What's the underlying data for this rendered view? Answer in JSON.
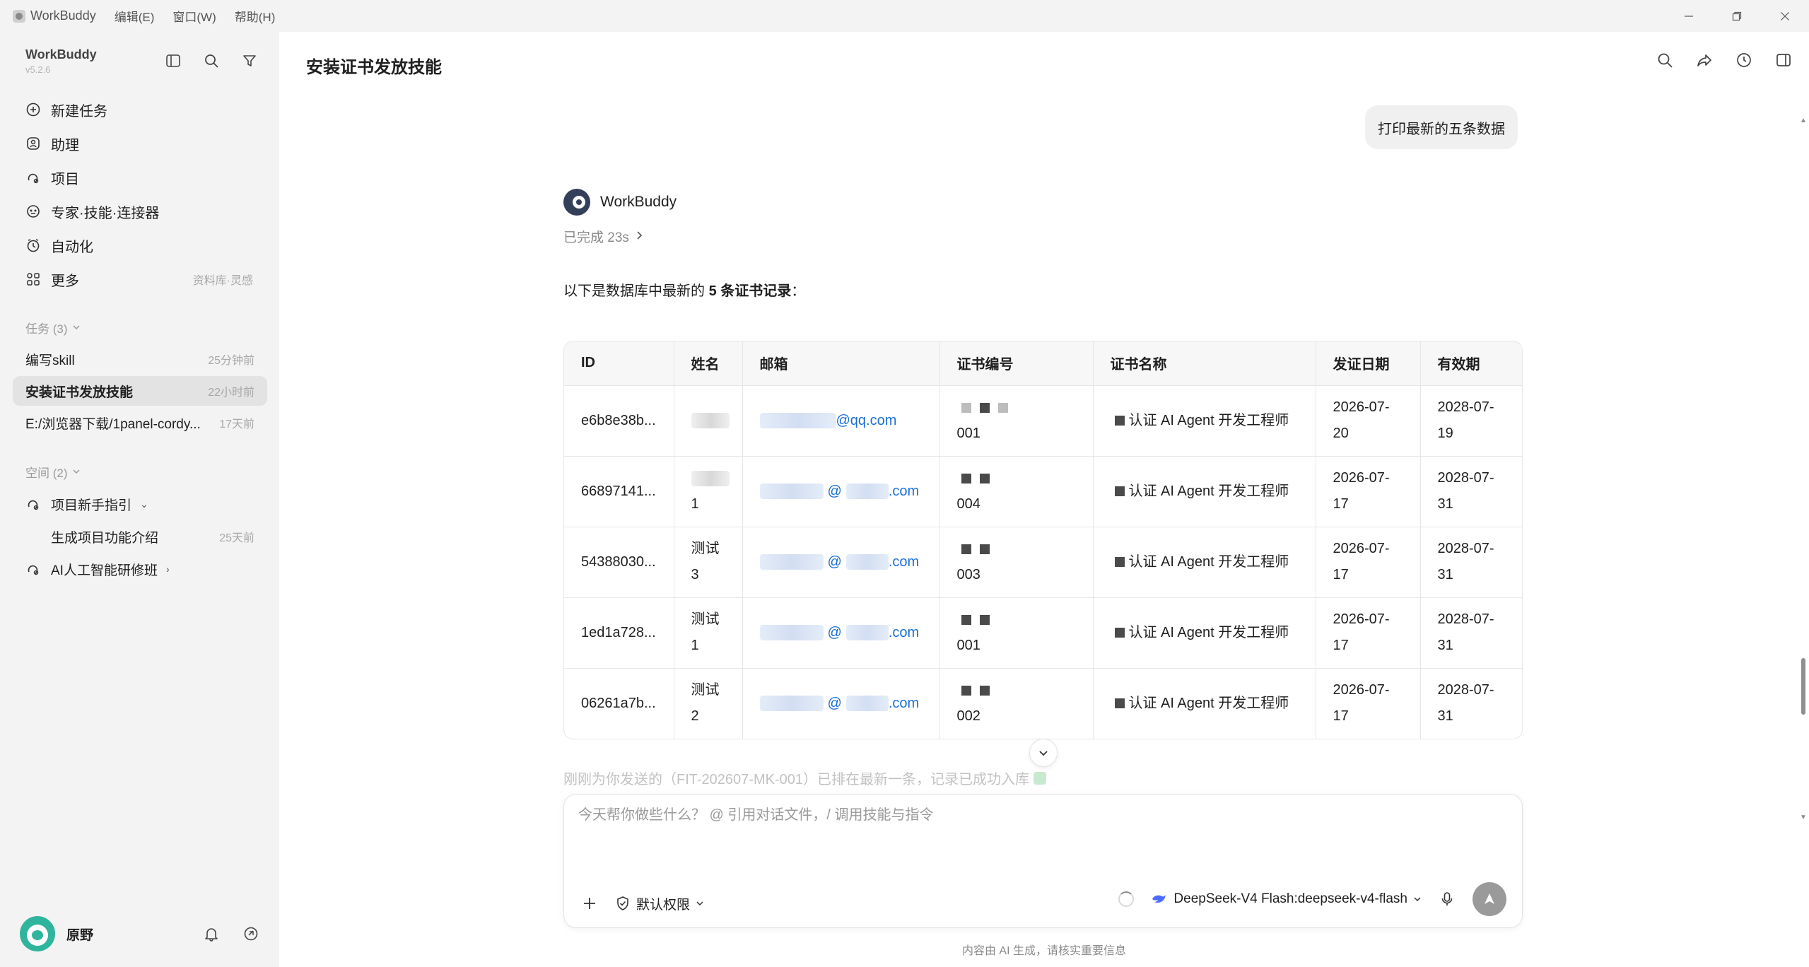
{
  "titlebar": {
    "app_name": "WorkBuddy",
    "menus": [
      "编辑(E)",
      "窗口(W)",
      "帮助(H)"
    ],
    "icons": [
      "minimize-icon",
      "restore-icon",
      "close-icon"
    ]
  },
  "sidebar": {
    "app_name": "WorkBuddy",
    "version": "v5.2.6",
    "tools": [
      "sidebar-toggle-icon",
      "search-icon",
      "filter-icon"
    ],
    "nav": [
      {
        "label": "新建任务",
        "icon": "plus-circle-icon",
        "hint": ""
      },
      {
        "label": "助理",
        "icon": "assistant-icon",
        "hint": ""
      },
      {
        "label": "项目",
        "icon": "project-icon",
        "hint": ""
      },
      {
        "label": "专家·技能·连接器",
        "icon": "expert-icon",
        "hint": ""
      },
      {
        "label": "自动化",
        "icon": "clock-icon",
        "hint": ""
      },
      {
        "label": "更多",
        "icon": "more-grid-icon",
        "hint": "资料库·灵感"
      }
    ],
    "tasks_section": "任务 (3)",
    "tasks": [
      {
        "label": "编写skill",
        "time": "25分钟前"
      },
      {
        "label": "安装证书发放技能",
        "time": "22小时前"
      },
      {
        "label": "E:/浏览器下载/1panel-cordy...",
        "time": "17天前"
      }
    ],
    "spaces_section": "空间 (2)",
    "spaces": [
      {
        "label": "项目新手指引",
        "chevron": "⌄"
      },
      {
        "label": "生成项目功能介绍",
        "time": "25天前"
      },
      {
        "label": "AI人工智能研修班",
        "chevron": "›"
      }
    ],
    "user": {
      "name": "原野"
    }
  },
  "main": {
    "title": "安装证书发放技能",
    "user_message": "打印最新的五条数据",
    "assistant": {
      "name": "WorkBuddy",
      "status": "已完成 23s",
      "intro_prefix": "以下是数据库中最新的 ",
      "intro_bold": "5 条证书记录",
      "intro_suffix": "："
    },
    "table": {
      "headers": [
        "ID",
        "姓名",
        "邮箱",
        "证书编号",
        "证书名称",
        "发证日期",
        "有效期"
      ],
      "rows": [
        {
          "id": "e6b8e38b...",
          "name": "",
          "email_suffix": "@qq.com",
          "cert_suffix": "001",
          "cert_name": "认证 AI Agent 开发工程师",
          "issue": "2026-07-20",
          "expiry": "2028-07-19"
        },
        {
          "id": "66897141...",
          "name": "1",
          "email_suffix": ".com",
          "cert_suffix": "004",
          "cert_name": "认证 AI Agent 开发工程师",
          "issue": "2026-07-17",
          "expiry": "2028-07-31"
        },
        {
          "id": "54388030...",
          "name": "测试3",
          "email_suffix": ".com",
          "cert_suffix": "003",
          "cert_name": "认证 AI Agent 开发工程师",
          "issue": "2026-07-17",
          "expiry": "2028-07-31"
        },
        {
          "id": "1ed1a728...",
          "name": "测试1",
          "email_suffix": ".com",
          "cert_suffix": "001",
          "cert_name": "认证 AI Agent 开发工程师",
          "issue": "2026-07-17",
          "expiry": "2028-07-31"
        },
        {
          "id": "06261a7b...",
          "name": "测试2",
          "email_suffix": ".com",
          "cert_suffix": "002",
          "cert_name": "认证 AI Agent 开发工程师",
          "issue": "2026-07-17",
          "expiry": "2028-07-31"
        }
      ]
    },
    "faded_text": "刚刚为你发送的（FIT-202607-MK-001）已排在最新一条，记录已成功入库",
    "composer": {
      "placeholder": "今天帮你做些什么？ @ 引用对话文件，/ 调用技能与指令",
      "permission": "默认权限",
      "model": "DeepSeek-V4 Flash:deepseek-v4-flash"
    },
    "disclaimer": "内容由 AI 生成，请核实重要信息"
  }
}
